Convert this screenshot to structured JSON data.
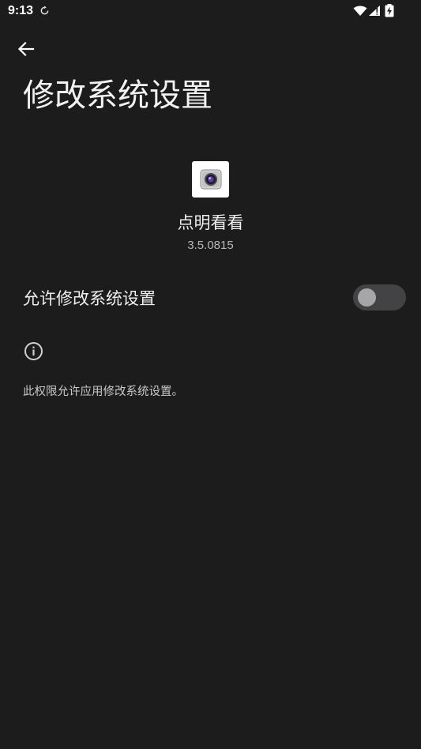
{
  "status_bar": {
    "time": "9:13",
    "icons": [
      "sync-icon",
      "wifi-icon",
      "cellular-signal-icon",
      "battery-charging-icon"
    ]
  },
  "header": {
    "back_icon": "arrow-left-icon",
    "title": "修改系统设置"
  },
  "app": {
    "icon": "camera-lens-icon",
    "name": "点明看看",
    "version": "3.5.0815"
  },
  "setting": {
    "label": "允许修改系统设置",
    "enabled": false
  },
  "info": {
    "icon": "info-icon",
    "description": "此权限允许应用修改系统设置。"
  },
  "colors": {
    "background": "#1c1c1d",
    "toggle_track_off": "#434346",
    "toggle_thumb_off": "#a6a6a9"
  }
}
